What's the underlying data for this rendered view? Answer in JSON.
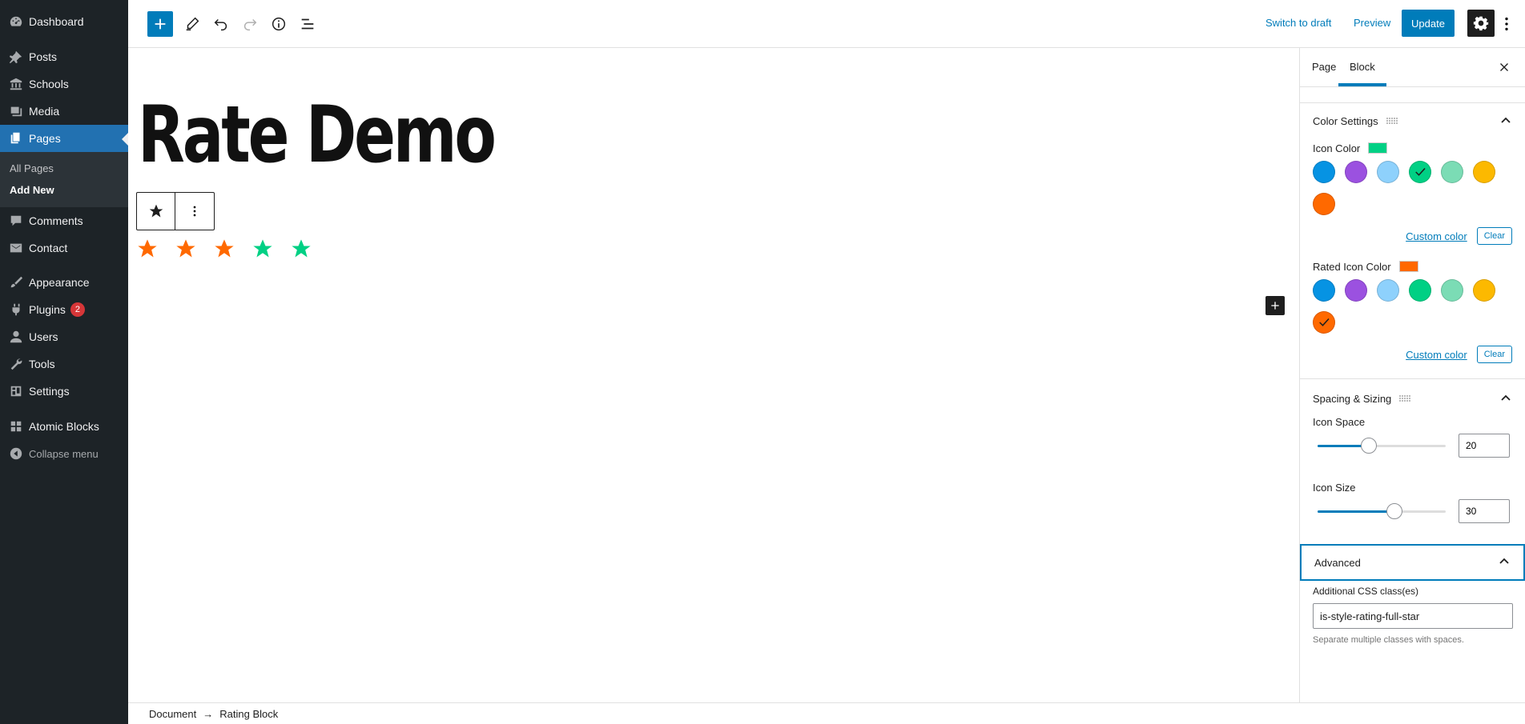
{
  "admin_menu": {
    "dashboard": "Dashboard",
    "posts": "Posts",
    "schools": "Schools",
    "media": "Media",
    "pages": "Pages",
    "pages_sub": [
      "All Pages",
      "Add New"
    ],
    "comments": "Comments",
    "contact": "Contact",
    "appearance": "Appearance",
    "plugins": "Plugins",
    "plugins_badge": "2",
    "users": "Users",
    "tools": "Tools",
    "settings": "Settings",
    "atomic_blocks": "Atomic Blocks",
    "collapse": "Collapse menu"
  },
  "toolbar": {
    "switch_to_draft": "Switch to draft",
    "preview": "Preview",
    "update": "Update"
  },
  "editor": {
    "title": "Rate Demo",
    "stars": [
      {
        "color": "#ff6900"
      },
      {
        "color": "#ff6900"
      },
      {
        "color": "#ff6900"
      },
      {
        "color": "#00d084"
      },
      {
        "color": "#00d084"
      }
    ]
  },
  "sidebar": {
    "tabs": [
      "Page",
      "Block"
    ],
    "color_settings": {
      "heading": "Color Settings",
      "icon_color_label": "Icon Color",
      "icon_color_value": "#00d084",
      "rated_icon_color_label": "Rated Icon Color",
      "rated_icon_color_value": "#ff6900",
      "palette": [
        "#0693e3",
        "#9b51e0",
        "#8ed1fc",
        "#00d084",
        "#7bdcb5",
        "#fcb900",
        "#ff6900"
      ],
      "custom_color": "Custom color",
      "clear": "Clear"
    },
    "spacing": {
      "heading": "Spacing & Sizing",
      "icon_space_label": "Icon Space",
      "icon_space_value": "20",
      "icon_space_fraction": 0.4,
      "icon_size_label": "Icon Size",
      "icon_size_value": "30",
      "icon_size_fraction": 0.6
    },
    "advanced": {
      "heading": "Advanced",
      "css_label": "Additional CSS class(es)",
      "css_value": "is-style-rating-full-star",
      "help": "Separate multiple classes with spaces."
    }
  },
  "footer": {
    "breadcrumb": [
      "Document",
      "Rating Block"
    ],
    "separator": "→"
  }
}
